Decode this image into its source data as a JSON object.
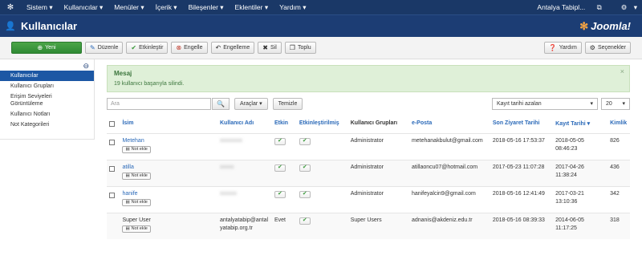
{
  "topnav": {
    "menu": [
      "Sistem ▾",
      "Kullanıcılar ▾",
      "Menüler ▾",
      "İçerik ▾",
      "Bileşenler ▾",
      "Eklentiler ▾",
      "Yardım ▾"
    ],
    "site": "Antalya Tabipl...",
    "site_icon": "external-link-icon",
    "user_icon": "gear-icon"
  },
  "header": {
    "title": "Kullanıcılar",
    "brand": "Joomla!"
  },
  "toolbar": {
    "new": "Yeni",
    "edit": "Düzenle",
    "activate": "Etkinleştir",
    "block": "Engelle",
    "unblock": "Engelleme",
    "delete": "Sil",
    "batch": "Toplu",
    "help": "Yardım",
    "options": "Seçenekler"
  },
  "sidebar": {
    "items": [
      "Kullanıcılar",
      "Kullanıcı Grupları",
      "Erişim Seviyeleri Görüntüleme",
      "Kullanıcı Notları",
      "Not Kategorileri"
    ]
  },
  "alert": {
    "heading": "Mesaj",
    "message": "19 kullanıcı başarıyla silindi."
  },
  "filters": {
    "search_placeholder": "Ara",
    "tools": "Araçlar ▾",
    "clear": "Temizle",
    "sort": "Kayıt tarihi azalan",
    "limit": "20"
  },
  "table": {
    "headers": {
      "name": "İsim",
      "username": "Kullanıcı Adı",
      "enabled": "Etkin",
      "activated": "Etkinleştirilmiş",
      "groups": "Kullanıcı Grupları",
      "email": "e-Posta",
      "last_visit": "Son Ziyaret Tarihi",
      "registered": "Kayıt Tarihi ▾",
      "id": "Kimlik"
    },
    "note_label": "Not ekle",
    "rows": [
      {
        "name": "Metehan",
        "username": "xxxxxxxx",
        "enabled": "✔",
        "activated": "✔",
        "group": "Administrator",
        "email": "metehanakbulut@gmail.com",
        "last_visit": "2018-05-16 17:53:37",
        "registered": "2018-05-05 08:46:23",
        "id": "826"
      },
      {
        "name": "atilla",
        "username": "xxxxx",
        "enabled": "✔",
        "activated": "✔",
        "group": "Administrator",
        "email": "atillaoncu07@hotmail.com",
        "last_visit": "2017-05-23 11:07:28",
        "registered": "2017-04-26 11:38:24",
        "id": "436"
      },
      {
        "name": "hanife",
        "username": "xxxxxx",
        "enabled": "✔",
        "activated": "✔",
        "group": "Administrator",
        "email": "hanifeyalcin9@gmail.com",
        "last_visit": "2018-05-16 12:41:49",
        "registered": "2017-03-21 13:10:36",
        "id": "342"
      },
      {
        "name": "Super User",
        "username": "antalyatabip@antalyatabip.org.tr",
        "enabled": "Evet",
        "activated": "✔",
        "group": "Super Users",
        "email": "adnanis@akdeniz.edu.tr",
        "last_visit": "2018-05-16 08:39:33",
        "registered": "2014-06-05 11:17:25",
        "id": "318"
      }
    ]
  }
}
